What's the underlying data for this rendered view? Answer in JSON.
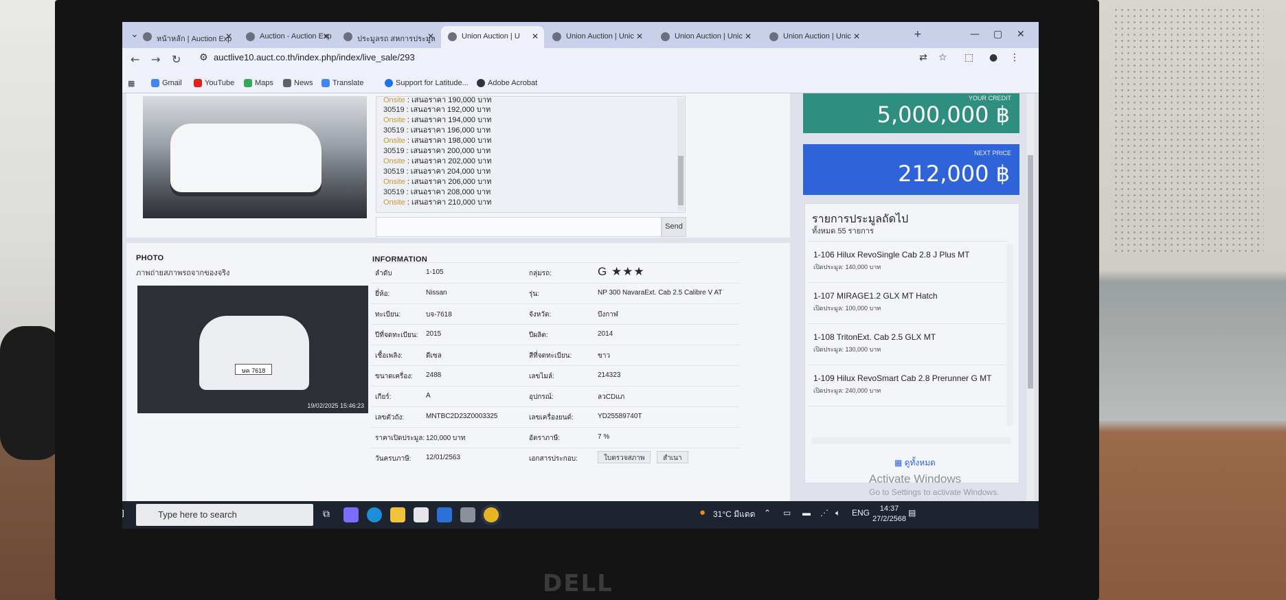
{
  "browser": {
    "tabs": [
      {
        "label": "หน้าหลัก | Auction Exp",
        "active": false
      },
      {
        "label": "Auction - Auction Exp",
        "active": false
      },
      {
        "label": "ประมูลรถ สหการประมูล",
        "active": false
      },
      {
        "label": "Union Auction | U",
        "active": true
      },
      {
        "label": "Union Auction | Unic",
        "active": false
      },
      {
        "label": "Union Auction | Unic",
        "active": false
      },
      {
        "label": "Union Auction | Unic",
        "active": false
      }
    ],
    "url": "auctlive10.auct.co.th/index.php/index/live_sale/293",
    "bookmarks": [
      "Gmail",
      "YouTube",
      "Maps",
      "News",
      "Translate",
      "Support for Latitude...",
      "Adobe Acrobat"
    ]
  },
  "chat": {
    "lines": [
      {
        "who": "Onsite",
        "text": "เสนอราคา 190,000 บาท"
      },
      {
        "who": "30519",
        "text": "เสนอราคา 192,000 บาท"
      },
      {
        "who": "Onsite",
        "text": "เสนอราคา 194,000 บาท"
      },
      {
        "who": "30519",
        "text": "เสนอราคา 196,000 บาท"
      },
      {
        "who": "Onsite",
        "text": "เสนอราคา 198,000 บาท"
      },
      {
        "who": "30519",
        "text": "เสนอราคา 200,000 บาท"
      },
      {
        "who": "Onsite",
        "text": "เสนอราคา 202,000 บาท"
      },
      {
        "who": "30519",
        "text": "เสนอราคา 204,000 บาท"
      },
      {
        "who": "Onsite",
        "text": "เสนอราคา 206,000 บาท"
      },
      {
        "who": "30519",
        "text": "เสนอราคา 208,000 บาท"
      },
      {
        "who": "Onsite",
        "text": "เสนอราคา 210,000 บาท"
      }
    ],
    "send_label": "Send"
  },
  "photo": {
    "heading": "PHOTO",
    "subheading": "ภาพถ่ายสภาพรถจากของจริง",
    "plate_text": "ษค 7618",
    "timestamp": "19/02/2025 15:46:23"
  },
  "info": {
    "heading": "INFORMATION",
    "rows": [
      {
        "l1": "ลำดับ",
        "v1": "1-105",
        "l2": "กลุ่มรถ:",
        "v2": "G ★★★"
      },
      {
        "l1": "ยี่ห้อ:",
        "v1": "Nissan",
        "l2": "รุ่น:",
        "v2": "NP 300 NavaraExt. Cab 2.5 Calibre V AT"
      },
      {
        "l1": "ทะเบียน:",
        "v1": "บจ-7618",
        "l2": "จังหวัด:",
        "v2": "บึงกาฬ"
      },
      {
        "l1": "ปีที่จดทะเบียน:",
        "v1": "2015",
        "l2": "ปีผลิต:",
        "v2": "2014"
      },
      {
        "l1": "เชื้อเพลิง:",
        "v1": "ดีเซล",
        "l2": "สีที่จดทะเบียน:",
        "v2": "ขาว"
      },
      {
        "l1": "ขนาดเครื่อง:",
        "v1": "2488",
        "l2": "เลขไมล์:",
        "v2": "214323"
      },
      {
        "l1": "เกียร์:",
        "v1": "A",
        "l2": "อุปกรณ์:",
        "v2": "ลวCDแภ"
      },
      {
        "l1": "เลขตัวถัง:",
        "v1": "MNTBC2D23Z0003325",
        "l2": "เลขเครื่องยนต์:",
        "v2": "YD25589740T"
      },
      {
        "l1": "ราคาเปิดประมูล:",
        "v1": "120,000 บาท",
        "l2": "อัตราภาษี:",
        "v2": "7 %"
      },
      {
        "l1": "วันครบภาษี:",
        "v1": "12/01/2563",
        "l2": "เอกสารประกอบ:",
        "v2": ""
      }
    ],
    "doc_buttons": [
      "ใบตรวจสภาพ",
      "สำเนา"
    ]
  },
  "credit": {
    "label": "YOUR CREDIT",
    "value": "5,000,000 ฿",
    "color": "#2e8f80"
  },
  "next_price": {
    "label": "NEXT PRICE",
    "value": "212,000 ฿",
    "color": "#2f63d8"
  },
  "upcoming": {
    "title": "รายการประมูลถัดไป",
    "count": "ทั้งหมด 55 รายการ",
    "items": [
      {
        "name": "1-106 Hilux RevoSingle Cab 2.8 J Plus MT",
        "price": "เปิดประมูล: 140,000 บาท"
      },
      {
        "name": "1-107 MIRAGE1.2 GLX MT Hatch",
        "price": "เปิดประมูล: 100,000 บาท"
      },
      {
        "name": "1-108 TritonExt. Cab 2.5 GLX MT",
        "price": "เปิดประมูล: 130,000 บาท"
      },
      {
        "name": "1-109 Hilux RevoSmart Cab 2.8 Prerunner G MT",
        "price": "เปิดประมูล: 240,000 บาท"
      }
    ],
    "view_all": "ดูทั้งหมด"
  },
  "watermark": {
    "line1": "Activate Windows",
    "line2": "Go to Settings to activate Windows."
  },
  "taskbar": {
    "search_placeholder": "Type here to search",
    "weather": "31°C มีแดด",
    "lang": "ENG",
    "time": "14:37",
    "date": "27/2/2568"
  },
  "bezel_brand": "DELL"
}
